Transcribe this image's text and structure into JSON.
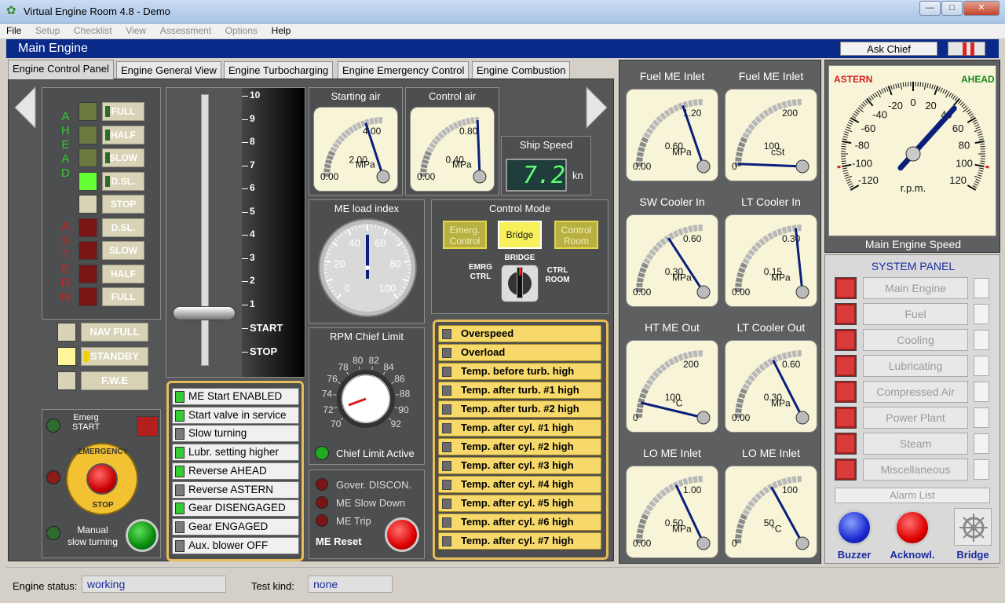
{
  "window": {
    "title": "Virtual Engine Room 4.8 - Demo",
    "min": "—",
    "max": "□",
    "close": "✕"
  },
  "menu": {
    "file": "File",
    "setup": "Setup",
    "checklist": "Checklist",
    "view": "View",
    "assessment": "Assessment",
    "options": "Options",
    "help": "Help"
  },
  "header": {
    "title": "Main Engine",
    "ask_chief": "Ask Chief",
    "pause": "▐▐"
  },
  "tabs": [
    "Engine Control Panel",
    "Engine General View",
    "Engine Turbocharging",
    "Engine Emergency Control",
    "Engine Combustion"
  ],
  "telegraph": {
    "ahead_letters": "A\nH\nE\nA\nD",
    "astern_letters": "A\nS\nT\nE\nR\nN",
    "buttons": [
      "FULL",
      "HALF",
      "SLOW",
      "D.SL.",
      "STOP",
      "D.SL.",
      "SLOW",
      "HALF",
      "FULL"
    ],
    "nav_full": "NAV FULL",
    "standby": "STANDBY",
    "fwe": "F.W.E"
  },
  "emergency": {
    "emerg_start": "Emerg\nSTART",
    "stop_label_top": "EMERGENCY",
    "stop_label_bottom": "STOP",
    "manual": "Manual\nslow turning"
  },
  "lever": {
    "scale": [
      "10",
      "9",
      "8",
      "7",
      "6",
      "5",
      "4",
      "3",
      "2",
      "1",
      "START",
      "STOP"
    ]
  },
  "starting_air": {
    "title": "Starting air",
    "unit": "MPa",
    "ticks": [
      "0.00",
      "2.00",
      "4.00"
    ],
    "value": 3.2
  },
  "control_air": {
    "title": "Control air",
    "unit": "MPa",
    "ticks": [
      "0.00",
      "0.40",
      "0.80"
    ],
    "value": 0.78
  },
  "ship_speed": {
    "title": "Ship Speed",
    "value": "7.2",
    "unit": "kn"
  },
  "load_index": {
    "title": "ME load index",
    "ticks": [
      "0",
      "20",
      "40",
      "60",
      "80",
      "100"
    ],
    "value": 50
  },
  "control_mode": {
    "title": "Control Mode",
    "buttons": [
      "Emerg.\nControl",
      "Bridge",
      "Control\nRoom"
    ],
    "switch_top": "BRIDGE",
    "switch_left": "EMRG\nCTRL",
    "switch_right": "CTRL\nROOM"
  },
  "rpm_chief": {
    "title": "RPM Chief Limit",
    "ticks": [
      "70",
      "72",
      "74",
      "76",
      "78",
      "80",
      "82",
      "84",
      "86",
      "88",
      "90",
      "92"
    ],
    "status": "Chief Limit Active"
  },
  "interlocks": [
    "ME Start ENABLED",
    "Start valve in service",
    "Slow turning",
    "Lubr. setting higher",
    "Reverse AHEAD",
    "Reverse ASTERN",
    "Gear DISENGAGED",
    "Gear ENGAGED",
    "Aux. blower OFF"
  ],
  "interlock_on": [
    true,
    true,
    false,
    true,
    true,
    false,
    true,
    false,
    false
  ],
  "governor": {
    "items": [
      "Gover. DISCON.",
      "ME Slow Down",
      "ME Trip"
    ],
    "reset": "ME Reset"
  },
  "alarms": [
    "Overspeed",
    "Overload",
    "Temp. before turb. high",
    "Temp. after turb. #1 high",
    "Temp. after turb. #2 high",
    "Temp. after cyl. #1 high",
    "Temp. after cyl. #2 high",
    "Temp. after cyl. #3 high",
    "Temp. after cyl. #4 high",
    "Temp. after cyl. #5 high",
    "Temp. after cyl. #6 high",
    "Temp. after cyl. #7 high"
  ],
  "gauges": [
    {
      "title": "Fuel ME Inlet",
      "unit": "MPa",
      "ticks": [
        "0.00",
        "0.60",
        "1.20"
      ],
      "value": 0.95
    },
    {
      "title": "Fuel ME Inlet",
      "unit": "cSt",
      "ticks": [
        "0",
        "100",
        "200"
      ],
      "value": 5
    },
    {
      "title": "SW Cooler In",
      "unit": "MPa",
      "ticks": [
        "0.00",
        "0.30",
        "0.60"
      ],
      "value": 0.38
    },
    {
      "title": "LT Cooler In",
      "unit": "MPa",
      "ticks": [
        "0.00",
        "0.15",
        "0.30"
      ],
      "value": 0.28
    },
    {
      "title": "HT ME Out",
      "unit": "°C",
      "ticks": [
        "0",
        "100",
        "200"
      ],
      "value": 30
    },
    {
      "title": "LT Cooler Out",
      "unit": "MPa",
      "ticks": [
        "0.00",
        "0.30",
        "0.60"
      ],
      "value": 0.42
    },
    {
      "title": "LO ME Inlet",
      "unit": "MPa",
      "ticks": [
        "0.00",
        "0.50",
        "1.00"
      ],
      "value": 0.72
    },
    {
      "title": "LO ME Inlet",
      "unit": "°C",
      "ticks": [
        "0",
        "50",
        "100"
      ],
      "value": 68
    }
  ],
  "rpm_gauge": {
    "title": "Main Engine Speed",
    "astern": "ASTERN",
    "ahead": "AHEAD",
    "unit": "r.p.m.",
    "ticks": [
      "-120",
      "-100",
      "-80",
      "-60",
      "-40",
      "-20",
      "0",
      "20",
      "40",
      "60",
      "80",
      "100",
      "120"
    ],
    "value": 42
  },
  "system_panel": {
    "title": "SYSTEM PANEL",
    "items": [
      "Main Engine",
      "Fuel",
      "Cooling",
      "Lubricating",
      "Compressed Air",
      "Power Plant",
      "Steam",
      "Miscellaneous"
    ],
    "alarm_list": "Alarm List",
    "buzzer": "Buzzer",
    "acknowl": "Acknowl.",
    "bridge": "Bridge"
  },
  "status": {
    "engine_status_label": "Engine status:",
    "engine_status": "working",
    "test_kind_label": "Test kind:",
    "test_kind": "none"
  },
  "colors": {
    "header": "#0a2a8a",
    "alarm_yellow": "#f6d96a",
    "led_green": "#33cc33",
    "red": "#d93a3a"
  }
}
